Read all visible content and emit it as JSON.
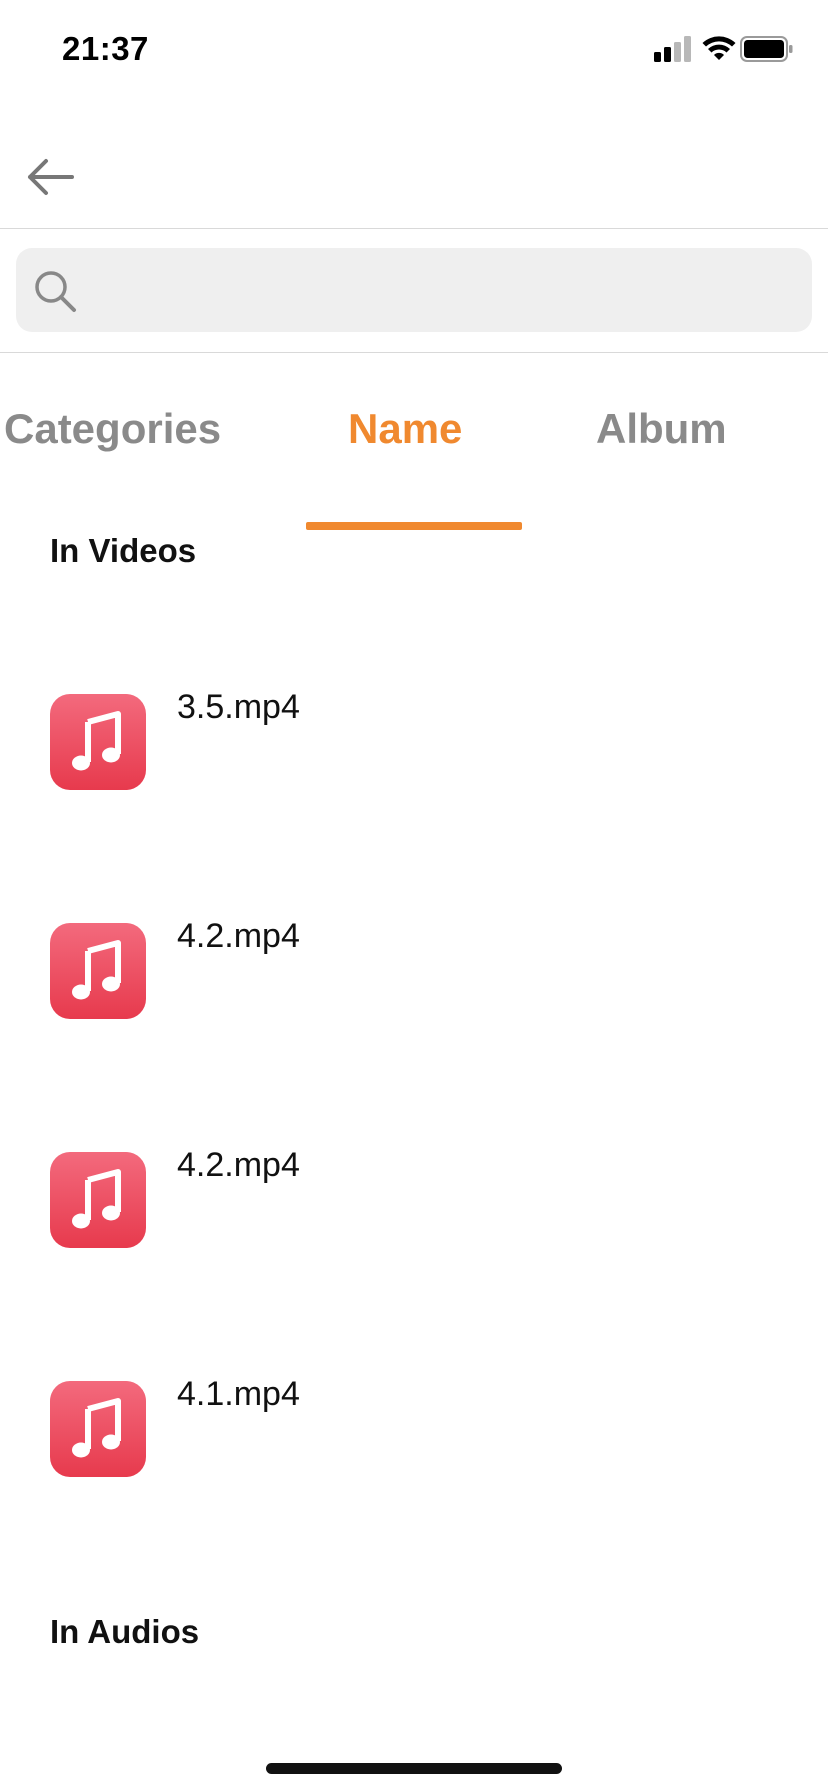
{
  "status_bar": {
    "time": "21:37",
    "icons": [
      "signal-icon",
      "wifi-icon",
      "battery-icon"
    ]
  },
  "header": {
    "back_icon": "arrow-left-icon"
  },
  "search": {
    "placeholder": "",
    "value": "",
    "icon": "search-icon"
  },
  "tabs": [
    {
      "label": "Categories",
      "active": false
    },
    {
      "label": "Name",
      "active": true
    },
    {
      "label": "Album",
      "active": false
    }
  ],
  "sections": {
    "videos": {
      "title": "In Videos",
      "items": [
        {
          "label": "3.5.mp4",
          "icon": "music-note-icon"
        },
        {
          "label": "4.2.mp4",
          "icon": "music-note-icon"
        },
        {
          "label": "4.2.mp4",
          "icon": "music-note-icon"
        },
        {
          "label": "4.1.mp4",
          "icon": "music-note-icon"
        }
      ]
    },
    "audios": {
      "title": "In Audios"
    }
  },
  "colors": {
    "accent": "#f0892f",
    "inactive_tab": "#8a8a8a",
    "icon_gradient_top": "#f36a7d",
    "icon_gradient_bottom": "#e73a4d",
    "search_bg": "#efefef"
  }
}
